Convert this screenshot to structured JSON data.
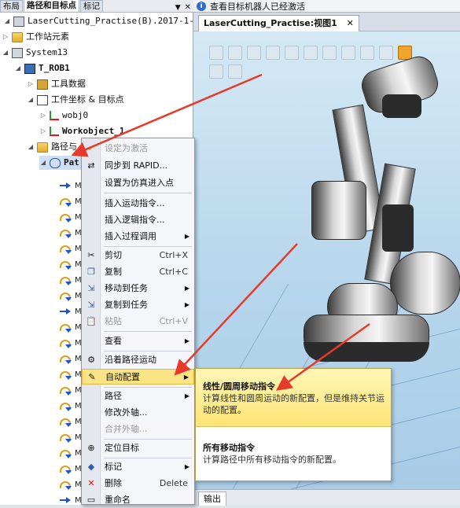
{
  "left_tabs": {
    "layout": "布局",
    "paths": "路径和目标点",
    "tags": "标记"
  },
  "tree": {
    "project": "LaserCutting_Practise(B).2017-1-",
    "station_elements": "工作站元素",
    "system": "System13",
    "robot": "T_ROB1",
    "tool_data": "工具数据",
    "workobjects_targets": "工件坐标 & 目标点",
    "wobj0": "wobj0",
    "workobject1": "Workobject_1",
    "paths_procedures": "路径与",
    "path_item": "Pat",
    "move_label": "M"
  },
  "status": {
    "message": "查看目标机器人已经激活"
  },
  "view": {
    "tab_title": "LaserCutting_Practise:视图1",
    "output_tab": "输出"
  },
  "context_menu": {
    "set_active": "设定为激活",
    "sync_rapid": "同步到 RAPID...",
    "set_sim_entry": "设置为仿真进入点",
    "insert_motion": "插入运动指令...",
    "insert_logic": "插入逻辑指令...",
    "insert_proc_call": "插入过程调用",
    "cut": "剪切",
    "cut_shortcut": "Ctrl+X",
    "copy": "复制",
    "copy_shortcut": "Ctrl+C",
    "move_to_task": "移动到任务",
    "copy_to_task": "复制到任务",
    "paste": "粘贴",
    "paste_shortcut": "Ctrl+V",
    "view": "查看",
    "move_along_path": "沿着路径运动",
    "auto_config": "自动配置",
    "path": "路径",
    "modify_external_axis": "修改外轴...",
    "merge_external_axis": "合并外轴...",
    "locate_target": "定位目标",
    "tag": "标记",
    "delete": "删除",
    "delete_shortcut": "Delete",
    "rename": "重命名"
  },
  "submenu": {
    "linear_circular_title": "线性/圆周移动指令",
    "linear_circular_desc": "计算线性和圆周运动的新配置，但是维持关节运动的配置。",
    "all_moves_title": "所有移动指令",
    "all_moves_desc": "计算路径中所有移动指令的新配置。"
  },
  "colors": {
    "highlight": "#fbe486",
    "arrow": "#e83a2a",
    "viewport_sky": "#c3def0"
  }
}
